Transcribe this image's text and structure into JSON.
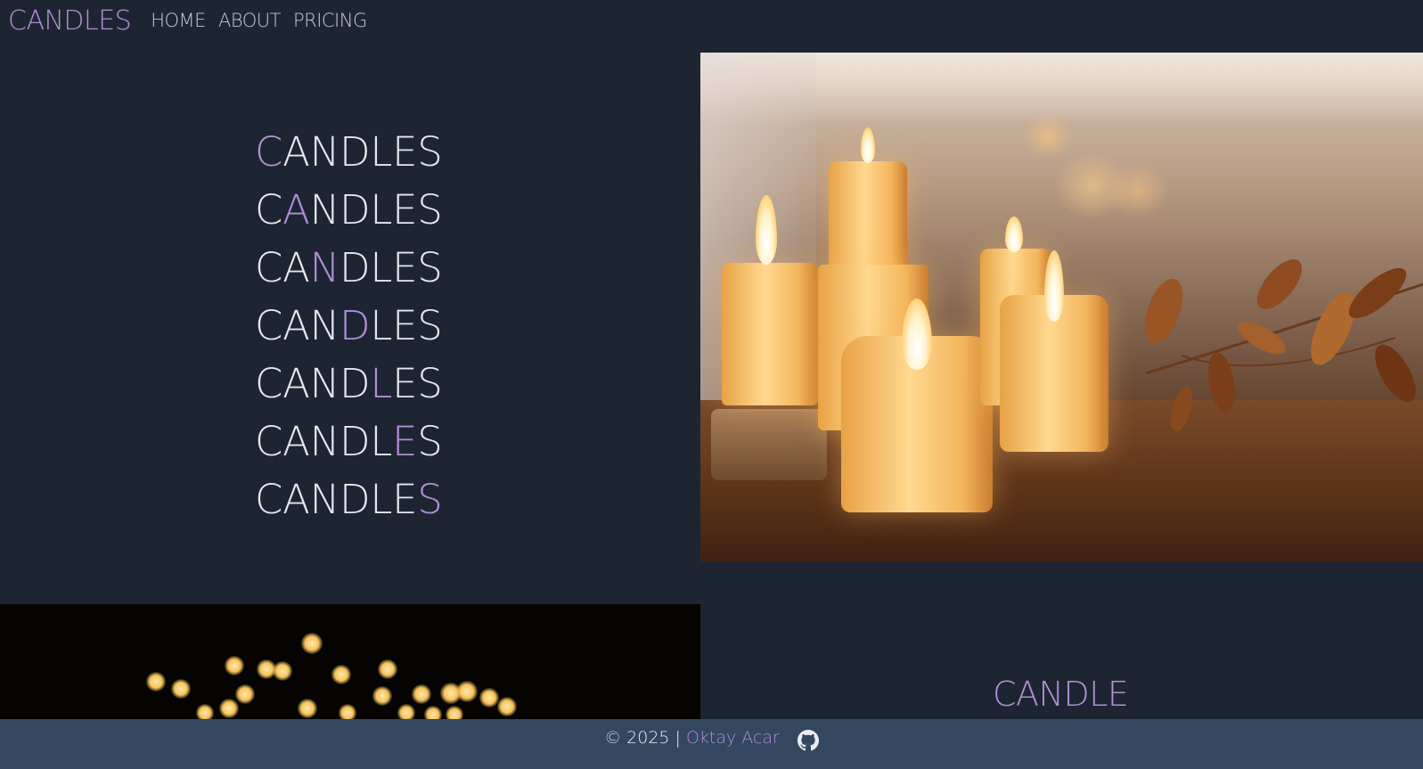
{
  "nav": {
    "brand": "CANDLES",
    "links": [
      "HOME",
      "ABOUT",
      "PRICING"
    ]
  },
  "hero": {
    "rows": [
      {
        "before": "",
        "hl": "C",
        "after": "ANDLES"
      },
      {
        "before": "C",
        "hl": "A",
        "after": "NDLES"
      },
      {
        "before": "CA",
        "hl": "N",
        "after": "DLES"
      },
      {
        "before": "CAN",
        "hl": "D",
        "after": "LES"
      },
      {
        "before": "CAND",
        "hl": "L",
        "after": "ES"
      },
      {
        "before": "CANDL",
        "hl": "E",
        "after": "S"
      },
      {
        "before": "CANDLE",
        "hl": "S",
        "after": ""
      }
    ]
  },
  "section2": {
    "label": "CANDLE"
  },
  "footer": {
    "copyright": "© 2025 |",
    "author": "Oktay Acar",
    "icon": "github-icon"
  },
  "colors": {
    "background": "#1d2532",
    "accent": "#b28fd6",
    "footer": "#33475f",
    "text": "#e6e8ec"
  }
}
